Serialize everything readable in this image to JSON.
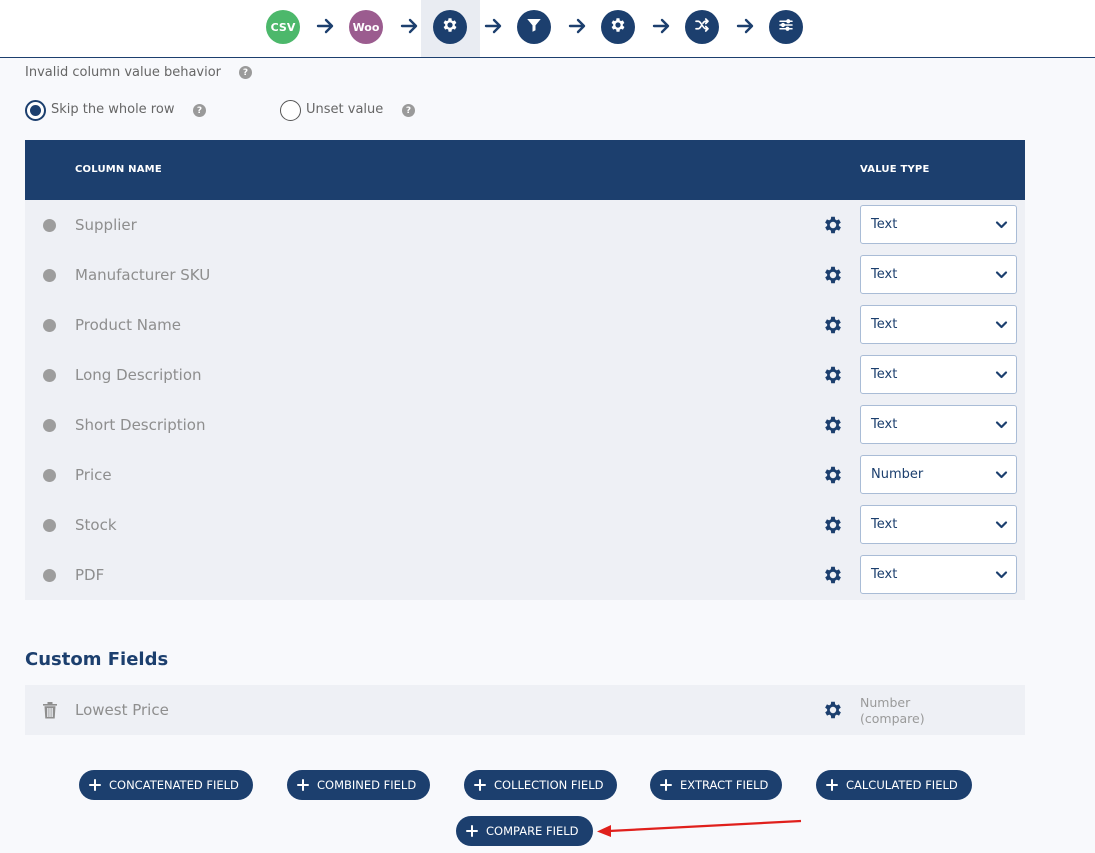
{
  "stepper": {
    "steps": [
      {
        "label": "CSV",
        "icon": "csv-icon"
      },
      {
        "label": "Woo",
        "icon": "woo-icon"
      },
      {
        "label": "",
        "icon": "gear-icon",
        "active": true
      },
      {
        "label": "",
        "icon": "filter-icon"
      },
      {
        "label": "",
        "icon": "gear-icon"
      },
      {
        "label": "",
        "icon": "shuffle-icon"
      },
      {
        "label": "",
        "icon": "sliders-icon"
      }
    ]
  },
  "behavior": {
    "label": "Invalid column value behavior",
    "options": [
      {
        "label": "Skip the whole row",
        "checked": true
      },
      {
        "label": "Unset value",
        "checked": false
      }
    ]
  },
  "table": {
    "headers": {
      "column_name": "COLUMN NAME",
      "value_type": "VALUE TYPE"
    },
    "rows": [
      {
        "name": "Supplier",
        "type": "Text"
      },
      {
        "name": "Manufacturer SKU",
        "type": "Text"
      },
      {
        "name": "Product Name",
        "type": "Text"
      },
      {
        "name": "Long Description",
        "type": "Text"
      },
      {
        "name": "Short Description",
        "type": "Text"
      },
      {
        "name": "Price",
        "type": "Number"
      },
      {
        "name": "Stock",
        "type": "Text"
      },
      {
        "name": "PDF",
        "type": "Text"
      }
    ]
  },
  "custom_fields": {
    "title": "Custom Fields",
    "rows": [
      {
        "name": "Lowest Price",
        "type_line1": "Number",
        "type_line2": "(compare)"
      }
    ]
  },
  "buttons": {
    "concatenated": "CONCATENATED FIELD",
    "combined": "COMBINED FIELD",
    "collection": "COLLECTION FIELD",
    "extract": "EXTRACT FIELD",
    "calculated": "CALCULATED FIELD",
    "compare": "COMPARE FIELD"
  },
  "colors": {
    "primary": "#1c3f6e",
    "csv_green": "#4cb86b",
    "woo_purple": "#9b5c8f",
    "annotation_red": "#e0201c"
  }
}
